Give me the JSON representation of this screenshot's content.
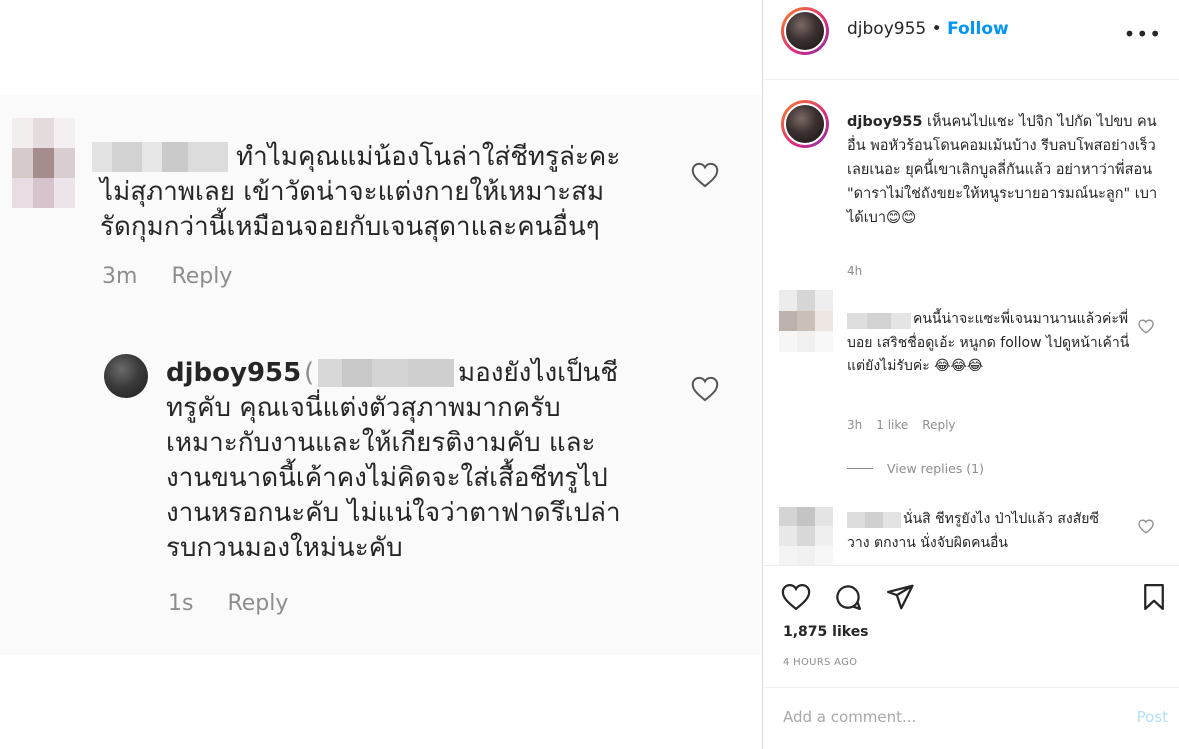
{
  "left": {
    "comment1": {
      "line1": "ทำไมคุณแม่น้องโนล่าใส่ชีทรูล่ะคะ",
      "line2": "ไม่สุภาพเลย เข้าวัดน่าจะแต่งกายให้เหมาะสม",
      "line3": "รัดกุมกว่านี้เหมือนจอยกับเจนสุดาและคนอื่นๆ",
      "time": "3m",
      "reply": "Reply"
    },
    "comment2": {
      "username": "djboy955",
      "open_paren": "(",
      "line1": "มองยังไงเป็นชี",
      "line2": "ทรูคับ คุณเจนี่แต่งตัวสุภาพมากครับ",
      "line3": "เหมาะกับงานและให้เกียรติงามคับ และ",
      "line4": "งานขนาดนี้เค้าคงไม่คิดจะใส่เสื้อชีทรูไป",
      "line5": "งานหรอกนะคับ ไม่แน่ใจว่าตาฟาดรึเปล่า",
      "line6": "รบกวนมองใหม่นะคับ",
      "time": "1s",
      "reply": "Reply"
    }
  },
  "right": {
    "header": {
      "username": "djboy955",
      "separator": "•",
      "follow": "Follow",
      "more": "•••"
    },
    "caption": {
      "username": "djboy955",
      "text": "เห็นคนไปแชะ ไปจิก ไปกัด ไปขบ คนอื่น พอหัวร้อนโดนคอมเม้นบ้าง รีบลบโพสอย่างเร็วเลยเนอะ ยุคนี้เขาเลิกบูลลี่กันแล้ว อย่าหาว่าพี่สอน \"ดาราไม่ใช่ถังขยะให้หนูระบายอารมณ์นะลูก\" เบาได้เบา😊😊",
      "time": "4h"
    },
    "comment1": {
      "text": "คนนี้น่าจะแซะพี่เจนมานานแล้วค่ะพี่บอย เสริชชื่อดูเอ้ะ หนูกด follow ไปดูหน้าเค้านี่ แต่ยังไม่รับค่ะ 😂😂😂",
      "time": "3h",
      "likes": "1 like",
      "reply": "Reply"
    },
    "view_replies": "View replies (1)",
    "comment2": {
      "text": "นั่นสิ ชีทรูยังไง ป่าไปแล้ว สงสัยซีวาง ตกงาน นั่งจับผิดคนอื่น"
    },
    "likes": "1,875 likes",
    "ago": "4 HOURS AGO",
    "add_comment": {
      "placeholder": "Add a comment...",
      "post": "Post"
    }
  },
  "colors": {
    "link_blue": "#0095f6",
    "muted": "#8e8e8e",
    "text": "#262626",
    "post_disabled": "#b2dffc"
  }
}
